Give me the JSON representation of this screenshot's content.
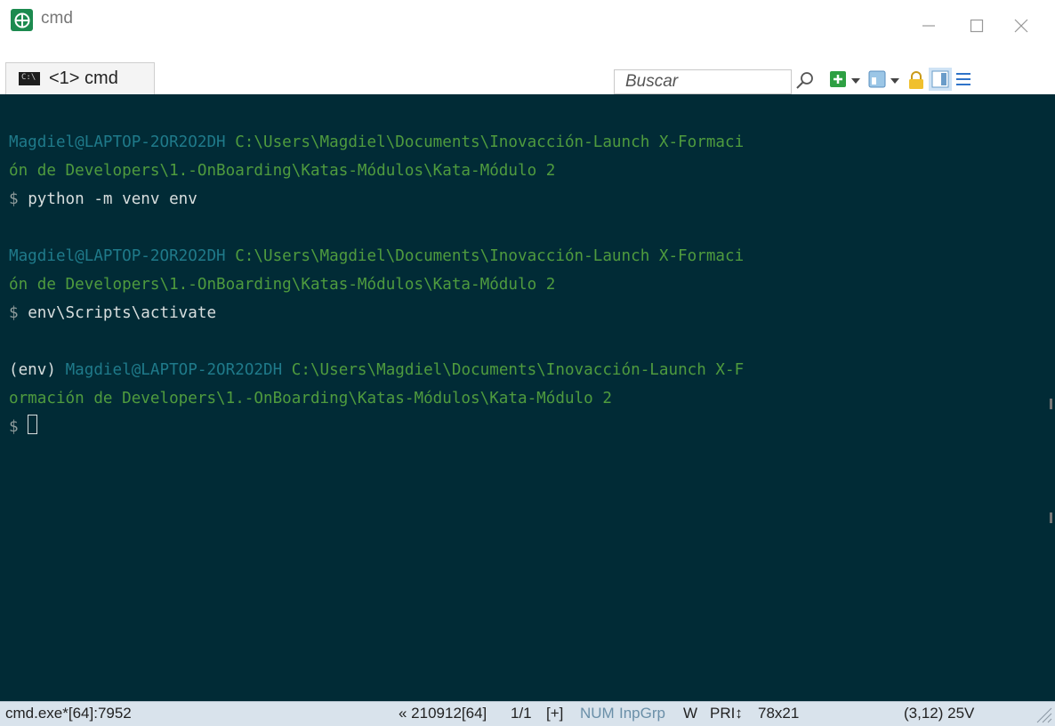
{
  "window": {
    "title": "cmd",
    "controls": {
      "minimize": "minimize-icon",
      "maximize": "maximize-icon",
      "close": "close-icon"
    }
  },
  "tabs": [
    {
      "label": "<1> cmd",
      "icon": "console-icon",
      "active": true
    }
  ],
  "toolbar": {
    "search_placeholder": "Buscar",
    "icons": [
      "search-icon",
      "new-console-icon",
      "dropdown-icon",
      "panes-icon",
      "dropdown-icon",
      "lock-icon",
      "layout-icon",
      "menu-icon"
    ]
  },
  "console": {
    "colors": {
      "background": "#012b36",
      "user": "#1f7a8a",
      "path": "#4f9b3e",
      "prompt": "#8f9c9c",
      "text": "#d8dede"
    },
    "blocks": [
      {
        "user": "Magdiel@LAPTOP-2OR2O2DH",
        "path_1": "C:\\Users\\Magdiel\\Documents\\Inovacción-Launch X-Formaci",
        "path_2": "ón de Developers\\1.-OnBoarding\\Katas-Módulos\\Kata-Módulo 2",
        "prompt": "$",
        "command": "python -m venv env"
      },
      {
        "user": "Magdiel@LAPTOP-2OR2O2DH",
        "path_1": "C:\\Users\\Magdiel\\Documents\\Inovacción-Launch X-Formaci",
        "path_2": "ón de Developers\\1.-OnBoarding\\Katas-Módulos\\Kata-Módulo 2",
        "prompt": "$",
        "command": "env\\Scripts\\activate"
      },
      {
        "env": "(env)",
        "user": "Magdiel@LAPTOP-2OR2O2DH",
        "path_1": "C:\\Users\\Magdiel\\Documents\\Inovacción-Launch X-F",
        "path_2": "ormación de Developers\\1.-OnBoarding\\Katas-Módulos\\Kata-Módulo 2",
        "prompt": "$",
        "command": ""
      }
    ]
  },
  "statusbar": {
    "process": "cmd.exe*[64]:7952",
    "pid": "« 210912[64]",
    "console_index": "1/1",
    "plus": "[+]",
    "num": "NUM",
    "inpgrp": "InpGrp",
    "w": "W",
    "pri": "PRI↕",
    "size": "78x21",
    "cursor_pos": "(3,12) 25V"
  }
}
